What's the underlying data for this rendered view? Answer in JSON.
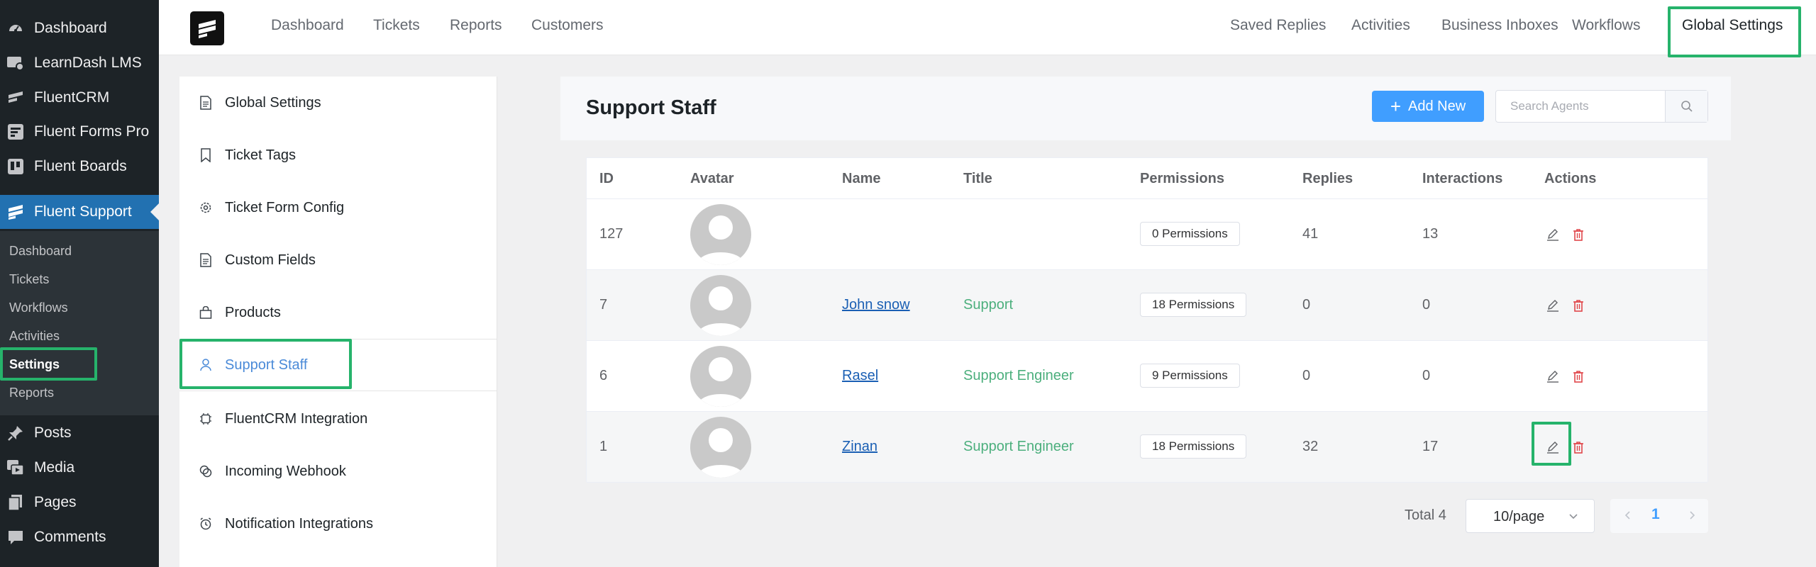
{
  "wp_sidebar": {
    "items": [
      {
        "label": "Dashboard",
        "icon": "dashboard-icon"
      },
      {
        "label": "LearnDash LMS",
        "icon": "learndash-icon"
      },
      {
        "label": "FluentCRM",
        "icon": "fluentcrm-icon"
      },
      {
        "label": "Fluent Forms Pro",
        "icon": "fluent-forms-icon"
      },
      {
        "label": "Fluent Boards",
        "icon": "fluent-boards-icon"
      },
      {
        "label": "Fluent Support",
        "icon": "fluent-support-icon"
      },
      {
        "label": "Posts",
        "icon": "pin-icon"
      },
      {
        "label": "Media",
        "icon": "media-icon"
      },
      {
        "label": "Pages",
        "icon": "pages-icon"
      },
      {
        "label": "Comments",
        "icon": "comments-icon"
      }
    ],
    "submenu": [
      "Dashboard",
      "Tickets",
      "Workflows",
      "Activities",
      "Settings",
      "Reports"
    ]
  },
  "topnav": {
    "left": [
      "Dashboard",
      "Tickets",
      "Reports",
      "Customers"
    ],
    "right": [
      "Saved Replies",
      "Activities",
      "Business Inboxes",
      "Workflows",
      "Global Settings"
    ]
  },
  "settings_menu": [
    {
      "label": "Global Settings",
      "icon": "document-icon"
    },
    {
      "label": "Ticket Tags",
      "icon": "bookmark-icon"
    },
    {
      "label": "Ticket Form Config",
      "icon": "gear-icon"
    },
    {
      "label": "Custom Fields",
      "icon": "document-icon"
    },
    {
      "label": "Products",
      "icon": "bag-icon"
    },
    {
      "label": "Support Staff",
      "icon": "user-icon"
    },
    {
      "label": "FluentCRM Integration",
      "icon": "chip-icon"
    },
    {
      "label": "Incoming Webhook",
      "icon": "webhook-icon"
    },
    {
      "label": "Notification Integrations",
      "icon": "alarm-icon"
    }
  ],
  "main": {
    "title": "Support Staff",
    "add_button": "Add New",
    "search_placeholder": "Search Agents",
    "columns": [
      "ID",
      "Avatar",
      "Name",
      "Title",
      "Permissions",
      "Replies",
      "Interactions",
      "Actions"
    ],
    "rows": [
      {
        "id": "127",
        "name": "",
        "title": "",
        "permissions": "0 Permissions",
        "replies": "41",
        "interactions": "13"
      },
      {
        "id": "7",
        "name": "John snow",
        "title": "Support",
        "permissions": "18 Permissions",
        "replies": "0",
        "interactions": "0"
      },
      {
        "id": "6",
        "name": "Rasel",
        "title": "Support Engineer",
        "permissions": "9 Permissions",
        "replies": "0",
        "interactions": "0"
      },
      {
        "id": "1",
        "name": "Zinan",
        "title": "Support Engineer",
        "permissions": "18 Permissions",
        "replies": "32",
        "interactions": "17"
      }
    ],
    "pagination": {
      "total": "Total 4",
      "page_size": "10/page",
      "current_page": "1"
    }
  },
  "colors": {
    "wp_active": "#2271b1",
    "primary": "#409eff",
    "highlight": "#26b36b",
    "title_green": "#4caf7d",
    "delete_red": "#e0464a"
  }
}
